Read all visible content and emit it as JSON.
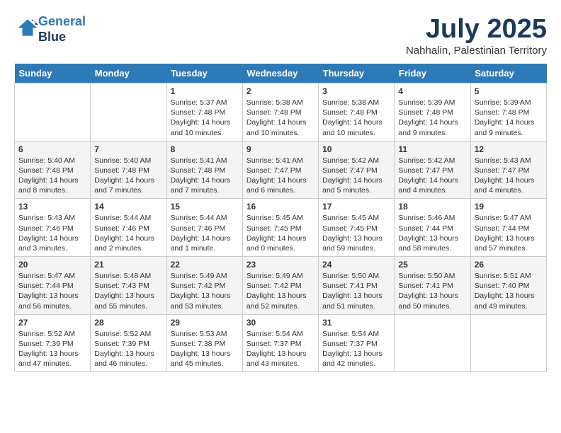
{
  "header": {
    "logo_line1": "General",
    "logo_line2": "Blue",
    "month": "July 2025",
    "location": "Nahhalin, Palestinian Territory"
  },
  "weekdays": [
    "Sunday",
    "Monday",
    "Tuesday",
    "Wednesday",
    "Thursday",
    "Friday",
    "Saturday"
  ],
  "weeks": [
    [
      {
        "day": "",
        "info": ""
      },
      {
        "day": "",
        "info": ""
      },
      {
        "day": "1",
        "info": "Sunrise: 5:37 AM\nSunset: 7:48 PM\nDaylight: 14 hours\nand 10 minutes."
      },
      {
        "day": "2",
        "info": "Sunrise: 5:38 AM\nSunset: 7:48 PM\nDaylight: 14 hours\nand 10 minutes."
      },
      {
        "day": "3",
        "info": "Sunrise: 5:38 AM\nSunset: 7:48 PM\nDaylight: 14 hours\nand 10 minutes."
      },
      {
        "day": "4",
        "info": "Sunrise: 5:39 AM\nSunset: 7:48 PM\nDaylight: 14 hours\nand 9 minutes."
      },
      {
        "day": "5",
        "info": "Sunrise: 5:39 AM\nSunset: 7:48 PM\nDaylight: 14 hours\nand 9 minutes."
      }
    ],
    [
      {
        "day": "6",
        "info": "Sunrise: 5:40 AM\nSunset: 7:48 PM\nDaylight: 14 hours\nand 8 minutes."
      },
      {
        "day": "7",
        "info": "Sunrise: 5:40 AM\nSunset: 7:48 PM\nDaylight: 14 hours\nand 7 minutes."
      },
      {
        "day": "8",
        "info": "Sunrise: 5:41 AM\nSunset: 7:48 PM\nDaylight: 14 hours\nand 7 minutes."
      },
      {
        "day": "9",
        "info": "Sunrise: 5:41 AM\nSunset: 7:47 PM\nDaylight: 14 hours\nand 6 minutes."
      },
      {
        "day": "10",
        "info": "Sunrise: 5:42 AM\nSunset: 7:47 PM\nDaylight: 14 hours\nand 5 minutes."
      },
      {
        "day": "11",
        "info": "Sunrise: 5:42 AM\nSunset: 7:47 PM\nDaylight: 14 hours\nand 4 minutes."
      },
      {
        "day": "12",
        "info": "Sunrise: 5:43 AM\nSunset: 7:47 PM\nDaylight: 14 hours\nand 4 minutes."
      }
    ],
    [
      {
        "day": "13",
        "info": "Sunrise: 5:43 AM\nSunset: 7:46 PM\nDaylight: 14 hours\nand 3 minutes."
      },
      {
        "day": "14",
        "info": "Sunrise: 5:44 AM\nSunset: 7:46 PM\nDaylight: 14 hours\nand 2 minutes."
      },
      {
        "day": "15",
        "info": "Sunrise: 5:44 AM\nSunset: 7:46 PM\nDaylight: 14 hours\nand 1 minute."
      },
      {
        "day": "16",
        "info": "Sunrise: 5:45 AM\nSunset: 7:45 PM\nDaylight: 14 hours\nand 0 minutes."
      },
      {
        "day": "17",
        "info": "Sunrise: 5:45 AM\nSunset: 7:45 PM\nDaylight: 13 hours\nand 59 minutes."
      },
      {
        "day": "18",
        "info": "Sunrise: 5:46 AM\nSunset: 7:44 PM\nDaylight: 13 hours\nand 58 minutes."
      },
      {
        "day": "19",
        "info": "Sunrise: 5:47 AM\nSunset: 7:44 PM\nDaylight: 13 hours\nand 57 minutes."
      }
    ],
    [
      {
        "day": "20",
        "info": "Sunrise: 5:47 AM\nSunset: 7:44 PM\nDaylight: 13 hours\nand 56 minutes."
      },
      {
        "day": "21",
        "info": "Sunrise: 5:48 AM\nSunset: 7:43 PM\nDaylight: 13 hours\nand 55 minutes."
      },
      {
        "day": "22",
        "info": "Sunrise: 5:49 AM\nSunset: 7:42 PM\nDaylight: 13 hours\nand 53 minutes."
      },
      {
        "day": "23",
        "info": "Sunrise: 5:49 AM\nSunset: 7:42 PM\nDaylight: 13 hours\nand 52 minutes."
      },
      {
        "day": "24",
        "info": "Sunrise: 5:50 AM\nSunset: 7:41 PM\nDaylight: 13 hours\nand 51 minutes."
      },
      {
        "day": "25",
        "info": "Sunrise: 5:50 AM\nSunset: 7:41 PM\nDaylight: 13 hours\nand 50 minutes."
      },
      {
        "day": "26",
        "info": "Sunrise: 5:51 AM\nSunset: 7:40 PM\nDaylight: 13 hours\nand 49 minutes."
      }
    ],
    [
      {
        "day": "27",
        "info": "Sunrise: 5:52 AM\nSunset: 7:39 PM\nDaylight: 13 hours\nand 47 minutes."
      },
      {
        "day": "28",
        "info": "Sunrise: 5:52 AM\nSunset: 7:39 PM\nDaylight: 13 hours\nand 46 minutes."
      },
      {
        "day": "29",
        "info": "Sunrise: 5:53 AM\nSunset: 7:38 PM\nDaylight: 13 hours\nand 45 minutes."
      },
      {
        "day": "30",
        "info": "Sunrise: 5:54 AM\nSunset: 7:37 PM\nDaylight: 13 hours\nand 43 minutes."
      },
      {
        "day": "31",
        "info": "Sunrise: 5:54 AM\nSunset: 7:37 PM\nDaylight: 13 hours\nand 42 minutes."
      },
      {
        "day": "",
        "info": ""
      },
      {
        "day": "",
        "info": ""
      }
    ]
  ]
}
